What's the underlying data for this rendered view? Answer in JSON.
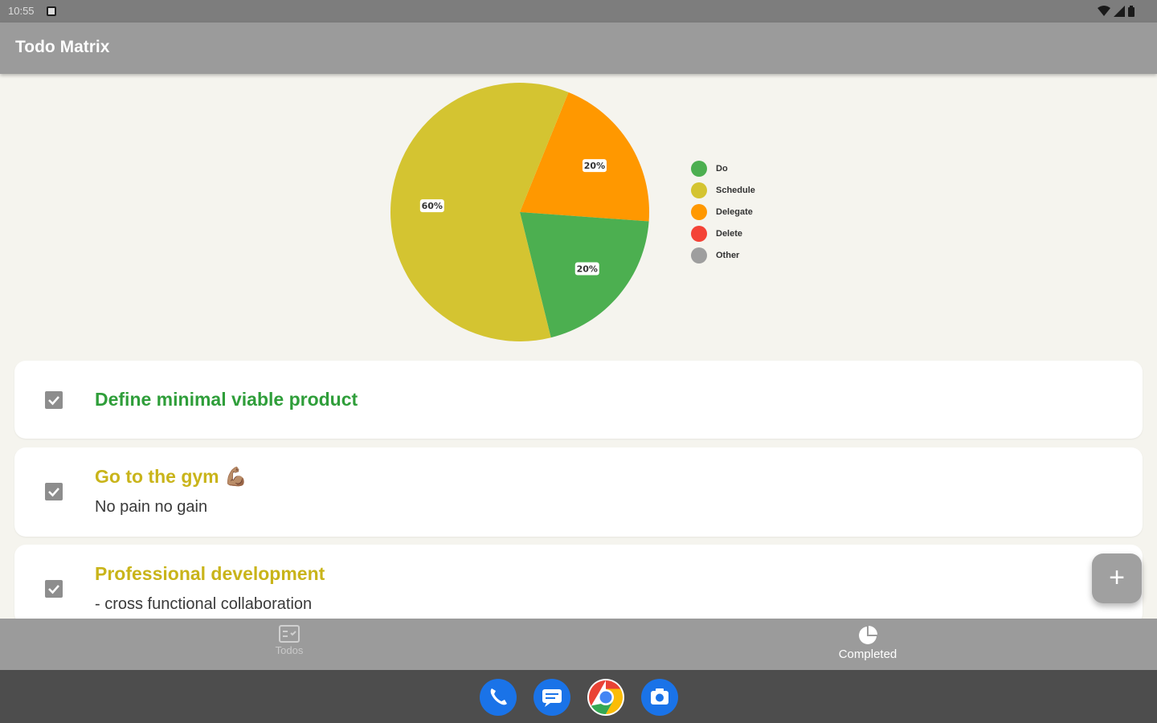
{
  "status_bar": {
    "time": "10:55"
  },
  "app_bar": {
    "title": "Todo Matrix"
  },
  "chart_data": {
    "type": "pie",
    "slices": [
      {
        "label": "Delegate",
        "value": 20,
        "color": "#ff9800",
        "data_label": "20%"
      },
      {
        "label": "Do",
        "value": 20,
        "color": "#4caf50",
        "data_label": "20%"
      },
      {
        "label": "Schedule",
        "value": 60,
        "color": "#d4c431",
        "data_label": "60%"
      }
    ],
    "legend": [
      {
        "label": "Do",
        "color": "#4caf50"
      },
      {
        "label": "Schedule",
        "color": "#d4c431"
      },
      {
        "label": "Delegate",
        "color": "#ff9800"
      },
      {
        "label": "Delete",
        "color": "#f44336"
      },
      {
        "label": "Other",
        "color": "#9e9e9e"
      }
    ],
    "legend_placement": "right"
  },
  "todos": [
    {
      "title": "Define minimal viable product",
      "subtitle": "",
      "checked": true,
      "color": "#2f9e3a"
    },
    {
      "title": "Go to the gym 💪🏽",
      "subtitle": "No pain no gain",
      "checked": true,
      "color": "#c9b41a"
    },
    {
      "title": "Professional development",
      "subtitle": "- cross functional collaboration",
      "checked": true,
      "color": "#c9b41a"
    }
  ],
  "fab": {
    "label": "+"
  },
  "bottom_nav": [
    {
      "label": "Todos",
      "icon": "checklist-icon",
      "active": false
    },
    {
      "label": "Completed",
      "icon": "pie-chart-icon",
      "active": true
    }
  ],
  "dock": [
    {
      "name": "phone",
      "icon": "phone-icon"
    },
    {
      "name": "messages",
      "icon": "messages-icon"
    },
    {
      "name": "chrome",
      "icon": "chrome-icon"
    },
    {
      "name": "camera",
      "icon": "camera-icon"
    }
  ]
}
